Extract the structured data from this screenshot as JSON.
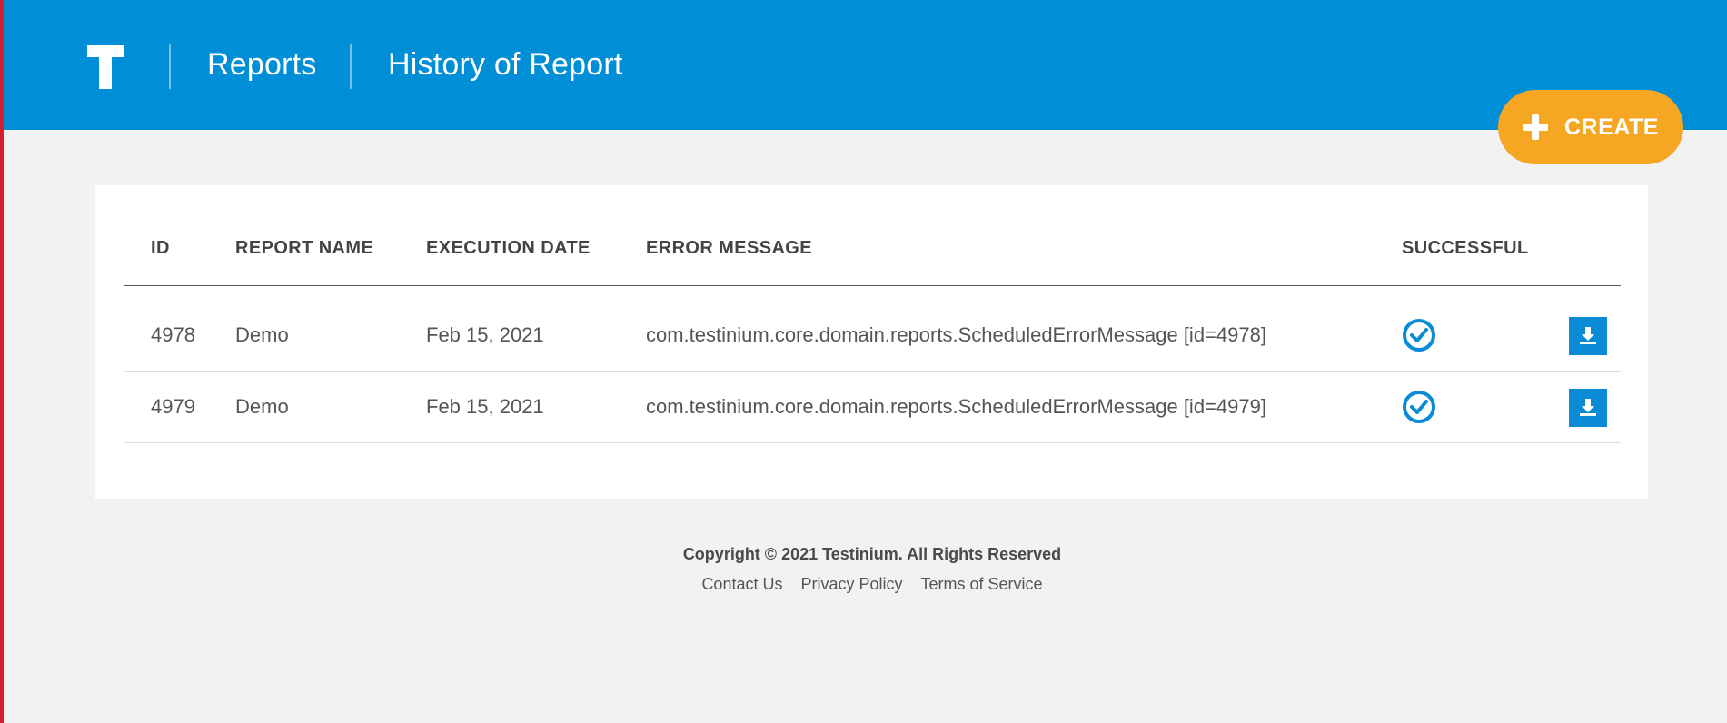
{
  "header": {
    "logo_letter": "T",
    "breadcrumb": [
      "Reports",
      "History of Report"
    ],
    "background": "#008fd7"
  },
  "create_button": {
    "label": "CREATE",
    "icon": "plus-icon",
    "color": "#f5a623"
  },
  "table": {
    "columns": [
      "ID",
      "REPORT NAME",
      "EXECUTION DATE",
      "ERROR MESSAGE",
      "SUCCESSFUL"
    ],
    "rows": [
      {
        "id": "4978",
        "report_name": "Demo",
        "execution_date": "Feb 15, 2021",
        "error_message": "com.testinium.core.domain.reports.ScheduledErrorMessage [id=4978]",
        "successful_icon": "check-circle-icon",
        "action_icon": "download-icon"
      },
      {
        "id": "4979",
        "report_name": "Demo",
        "execution_date": "Feb 15, 2021",
        "error_message": "com.testinium.core.domain.reports.ScheduledErrorMessage [id=4979]",
        "successful_icon": "check-circle-icon",
        "action_icon": "download-icon"
      }
    ]
  },
  "footer": {
    "copyright": "Copyright © 2021 Testinium. All Rights Reserved",
    "links": [
      "Contact Us",
      "Privacy Policy",
      "Terms of Service"
    ]
  },
  "colors": {
    "accent_blue": "#008fd7",
    "action_orange": "#f5a623",
    "left_edge": "#d0202e"
  }
}
